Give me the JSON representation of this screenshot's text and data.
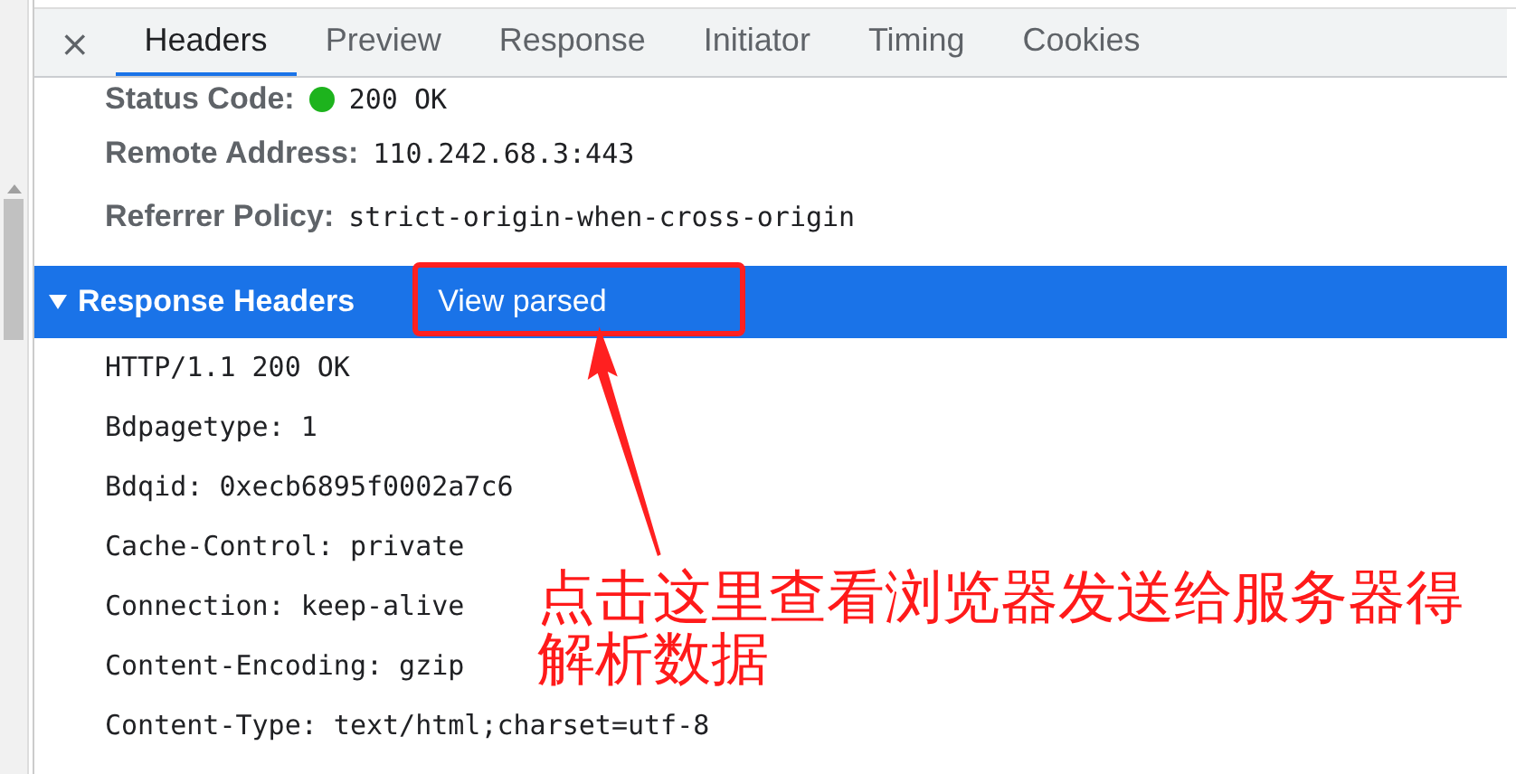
{
  "tabs": [
    {
      "label": "Headers",
      "selected": true
    },
    {
      "label": "Preview",
      "selected": false
    },
    {
      "label": "Response",
      "selected": false
    },
    {
      "label": "Initiator",
      "selected": false
    },
    {
      "label": "Timing",
      "selected": false
    },
    {
      "label": "Cookies",
      "selected": false
    }
  ],
  "close": "×",
  "general": [
    {
      "name": "Status Code:",
      "value": "200 OK",
      "ok": true
    },
    {
      "name": "Remote Address:",
      "value": "110.242.68.3:443"
    },
    {
      "name": "Referrer Policy:",
      "value": "strict-origin-when-cross-origin"
    }
  ],
  "response_headers": {
    "title": "Response Headers",
    "expanded": true,
    "link": "View parsed",
    "lines": [
      "HTTP/1.1 200 OK",
      "Bdpagetype: 1",
      "Bdqid: 0xecb6895f0002a7c6",
      "Cache-Control: private",
      "Connection: keep-alive",
      "Content-Encoding: gzip",
      "Content-Type: text/html;charset=utf-8"
    ]
  },
  "annotation": {
    "text": "点击这里查看浏览器发送给服务器得解析数据"
  }
}
